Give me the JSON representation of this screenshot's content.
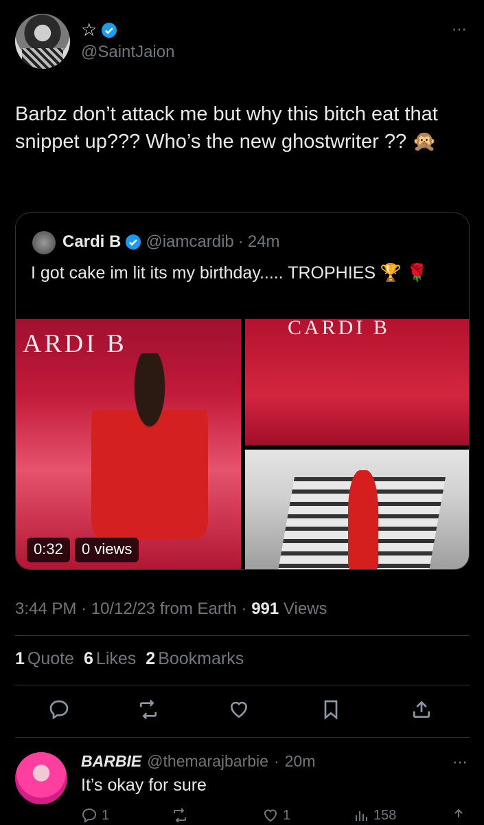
{
  "author": {
    "display_name": "☆",
    "handle": "@SaintJaion"
  },
  "tweet": {
    "text": "Barbz don’t attack me but why this bitch eat that snippet up??? Who’s the new ghostwriter ?? 🙊"
  },
  "quote": {
    "name": "Cardi B",
    "handle": "@iamcardib",
    "sep": "·",
    "time": "24m",
    "text": "I got cake im lit its my birthday..... TROPHIES 🏆 🌹",
    "media": {
      "video_time": "0:32",
      "video_views": "0 views",
      "brand_left": "ARDI B",
      "brand_right": "CARDI B"
    }
  },
  "meta": {
    "time": "3:44 PM",
    "sep1": "·",
    "date": "10/12/23",
    "source": "from Earth",
    "sep2": "·",
    "views_count": "991",
    "views_label": "Views"
  },
  "stats": {
    "quotes_count": "1",
    "quotes_label": "Quote",
    "likes_count": "6",
    "likes_label": "Likes",
    "bookmarks_count": "2",
    "bookmarks_label": "Bookmarks"
  },
  "reply": {
    "name": "BARBIE",
    "handle": "@themarajbarbie",
    "sep": "·",
    "time": "20m",
    "text": "It’s okay for sure",
    "replies": "1",
    "likes": "1",
    "views": "158"
  },
  "icons": {
    "more": "⋯"
  },
  "colors": {
    "background": "#000000",
    "text": "#e7e9ea",
    "muted": "#71767b",
    "verified": "#1d9bf0"
  }
}
